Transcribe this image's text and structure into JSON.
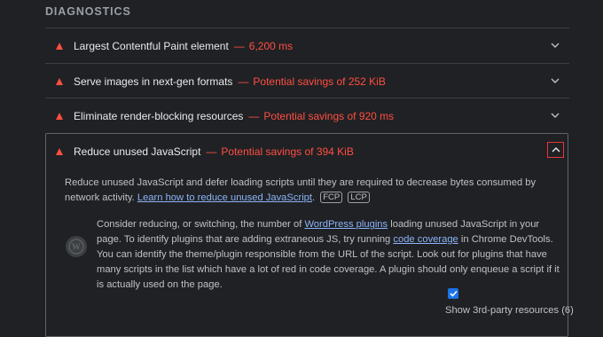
{
  "section": {
    "title": "DIAGNOSTICS"
  },
  "audits": [
    {
      "title": "Largest Contentful Paint element",
      "separator": "—",
      "value": "6,200 ms",
      "expanded": false
    },
    {
      "title": "Serve images in next-gen formats",
      "separator": "—",
      "value": "Potential savings of 252 KiB",
      "expanded": false
    },
    {
      "title": "Eliminate render-blocking resources",
      "separator": "—",
      "value": "Potential savings of 920 ms",
      "expanded": false
    },
    {
      "title": "Reduce unused JavaScript",
      "separator": "—",
      "value": "Potential savings of 394 KiB",
      "expanded": true
    }
  ],
  "details": {
    "description": "Reduce unused JavaScript and defer loading scripts until they are required to decrease bytes consumed by network activity.",
    "learn_link": "Learn how to reduce unused JavaScript",
    "period": ".",
    "badges": [
      "FCP",
      "LCP"
    ],
    "plugin_note": {
      "part1": "Consider reducing, or switching, the number of ",
      "link1": "WordPress plugins",
      "part2": " loading unused JavaScript in your page. To identify plugins that are adding extraneous JS, try running ",
      "link2": "code coverage",
      "part3": " in Chrome DevTools. You can identify the theme/plugin responsible from the URL of the script. Look out for plugins that have many scripts in the list which have a lot of red in code coverage. A plugin should only enqueue a script if it is actually used on the page."
    },
    "show_third_party_label": "Show 3rd-party resources (6)",
    "show_third_party_checked": true
  },
  "icons": {
    "fail": "red-triangle-icon",
    "collapse": "chevron-down-icon",
    "expand": "chevron-up-icon",
    "stack": "wordpress-icon",
    "check": "checkmark-icon"
  },
  "colors": {
    "background": "#202124",
    "fail": "#ff4e42",
    "link": "#8ab4f8",
    "checkbox": "#1a73e8",
    "focus_ring": "#e53935"
  }
}
